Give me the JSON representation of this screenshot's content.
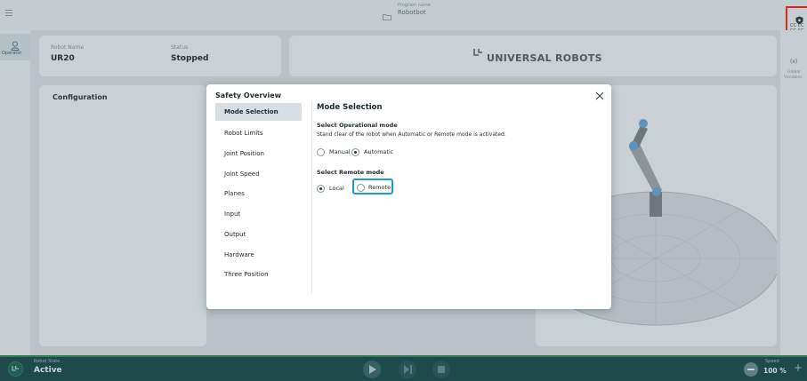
{
  "topbar": {
    "program_label": "Program name",
    "program_name": "Robotbot"
  },
  "left_rail": {
    "operator_label": "Operator"
  },
  "right_rail": {
    "code_top": "CC CC",
    "code_bottom": "CC CC",
    "variables_top": "Global",
    "variables_bottom": "Variables",
    "variables_symbol": "(x)"
  },
  "info_card": {
    "robot_name_label": "Robot Name",
    "robot_name": "UR20",
    "status_label": "Status",
    "status": "Stopped"
  },
  "brand": {
    "logo_text": "UNIVERSAL ROBOTS"
  },
  "config_card": {
    "title": "Configuration"
  },
  "bottombar": {
    "robot_state_label": "Robot State",
    "robot_state": "Active",
    "speed_label": "Speed",
    "speed_value": "100 %"
  },
  "modal": {
    "sidebar_title": "Safety Overview",
    "sidebar_items": [
      "Mode Selection",
      "Robot Limits",
      "Joint Position",
      "Joint Speed",
      "Planes",
      "Input",
      "Output",
      "Hardware",
      "Three Position"
    ],
    "title": "Mode Selection",
    "operational_heading": "Select Operational mode",
    "operational_desc": "Stand clear of the robot when Automatic or Remote mode is activated.",
    "operational_options": [
      "Manual",
      "Automatic"
    ],
    "remote_heading": "Select Remote mode",
    "remote_options": [
      "Local",
      "Remote"
    ]
  },
  "colors": {
    "highlight": "#1a9ad6",
    "alert": "#e0261d",
    "accent": "#2f7c4e"
  }
}
